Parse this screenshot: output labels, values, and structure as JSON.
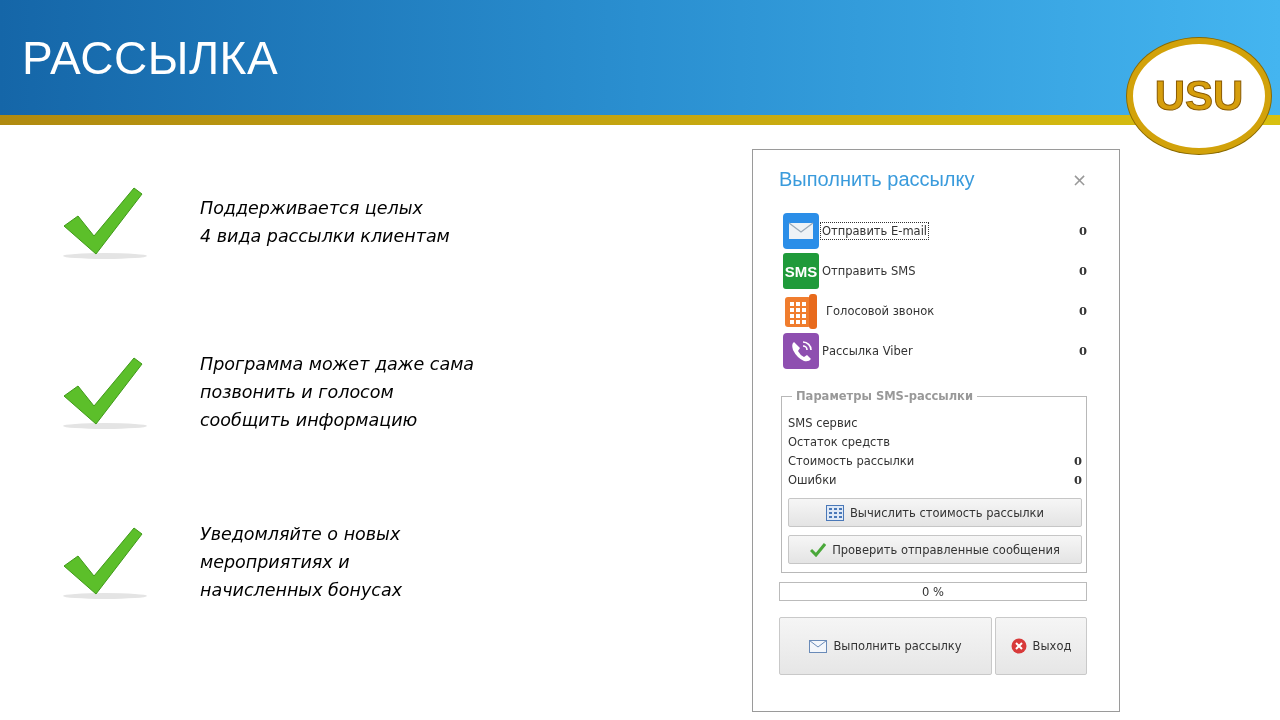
{
  "header": {
    "title": "РАССЫЛКА",
    "logo_text": "USU"
  },
  "features": [
    {
      "lines": [
        "Поддерживается целых",
        "4 вида рассылки клиентам"
      ]
    },
    {
      "lines": [
        "Программа может даже сама",
        "позвонить и голосом",
        "сообщить информацию"
      ]
    },
    {
      "lines": [
        "Уведомляйте о новых",
        "мероприятиях и",
        "начисленных бонусах"
      ]
    }
  ],
  "dialog": {
    "title": "Выполнить рассылку",
    "close": "×",
    "channels": [
      {
        "kind": "email",
        "label": "Отправить E-mail",
        "count": "0",
        "focused": true
      },
      {
        "kind": "sms",
        "icon_text": "SMS",
        "label": "Отправить SMS",
        "count": "0",
        "focused": false
      },
      {
        "kind": "phone",
        "label": "Голосовой звонок",
        "count": "0",
        "focused": false
      },
      {
        "kind": "viber",
        "label": "Рассылка Viber",
        "count": "0",
        "focused": false
      }
    ],
    "sms_params": {
      "legend": "Параметры SMS-рассылки",
      "fields": [
        {
          "label": "SMS сервис"
        },
        {
          "label": "Остаток средств"
        },
        {
          "label": "Стоимость рассылки",
          "value": "0"
        },
        {
          "label": "Ошибки",
          "value": "0"
        }
      ],
      "buttons": [
        {
          "kind": "calculator",
          "label": "Вычислить стоимость рассылки"
        },
        {
          "kind": "check",
          "label": "Проверить отправленные сообщения"
        }
      ]
    },
    "progress": {
      "level": 0,
      "reading": "0 %"
    },
    "actions": [
      {
        "kind": "send",
        "label": "Выполнить рассылку"
      },
      {
        "kind": "exit",
        "label": "Выход"
      }
    ]
  }
}
